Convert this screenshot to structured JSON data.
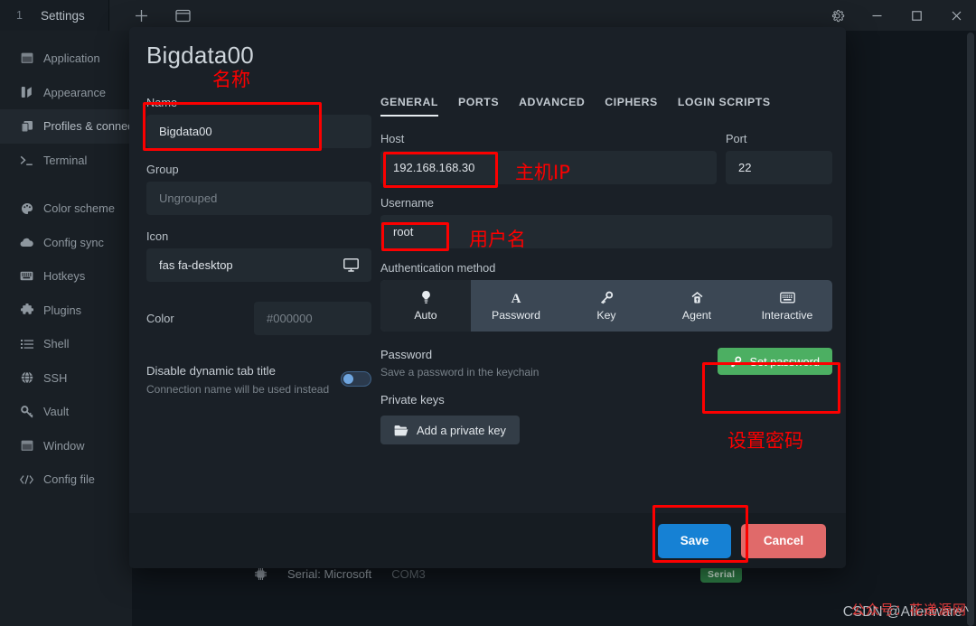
{
  "titlebar": {
    "tab_index": "1",
    "tab_label": "Settings",
    "new_tab_icon": "plus-icon",
    "split_icon": "window-split-icon",
    "gear_icon": "gear-icon",
    "minimize_label": "—",
    "maximize_label": "□",
    "close_label": "✕"
  },
  "sidebar": {
    "items": [
      {
        "label": "Application",
        "icon": "window-icon",
        "active": false
      },
      {
        "label": "Appearance",
        "icon": "palette-brush-icon",
        "active": false
      },
      {
        "label": "Profiles & connections",
        "icon": "layers-icon",
        "active": true
      },
      {
        "label": "Terminal",
        "icon": "terminal-prompt-icon",
        "active": false
      },
      {
        "label": "Color scheme",
        "icon": "palette-icon",
        "active": false
      },
      {
        "label": "Config sync",
        "icon": "cloud-icon",
        "active": false
      },
      {
        "label": "Hotkeys",
        "icon": "keyboard-icon",
        "active": false
      },
      {
        "label": "Plugins",
        "icon": "puzzle-icon",
        "active": false
      },
      {
        "label": "Shell",
        "icon": "list-icon",
        "active": false
      },
      {
        "label": "SSH",
        "icon": "globe-icon",
        "active": false
      },
      {
        "label": "Vault",
        "icon": "key-icon",
        "active": false
      },
      {
        "label": "Window",
        "icon": "window-icon",
        "active": false
      },
      {
        "label": "Config file",
        "icon": "code-icon",
        "active": false
      }
    ]
  },
  "background": {
    "connection_icon": "chip-icon",
    "connection_title": "Serial: Microsoft",
    "connection_sub": "COM3",
    "connection_badge": "Serial"
  },
  "modal": {
    "title": "Bigdata00",
    "left": {
      "name_label": "Name",
      "name_value": "Bigdata00",
      "group_label": "Group",
      "group_placeholder": "Ungrouped",
      "icon_label": "Icon",
      "icon_value": "fas fa-desktop",
      "icon_preview": "desktop-icon",
      "color_label": "Color",
      "color_placeholder": "#000000",
      "toggle_title": "Disable dynamic tab title",
      "toggle_sub": "Connection name will be used instead",
      "toggle_state": "off"
    },
    "tabs": [
      {
        "label": "GENERAL",
        "active": true
      },
      {
        "label": "PORTS",
        "active": false
      },
      {
        "label": "ADVANCED",
        "active": false
      },
      {
        "label": "CIPHERS",
        "active": false
      },
      {
        "label": "LOGIN SCRIPTS",
        "active": false
      }
    ],
    "general": {
      "host_label": "Host",
      "host_value": "192.168.168.30",
      "port_label": "Port",
      "port_value": "22",
      "username_label": "Username",
      "username_value": "root",
      "auth_label": "Authentication method",
      "auth_methods": [
        {
          "label": "Auto",
          "icon": "lightbulb-icon",
          "active": true
        },
        {
          "label": "Password",
          "icon": "letter-a-icon",
          "active": false
        },
        {
          "label": "Key",
          "icon": "key-icon",
          "active": false
        },
        {
          "label": "Agent",
          "icon": "agent-icon",
          "active": false
        },
        {
          "label": "Interactive",
          "icon": "keyboard-icon",
          "active": false
        }
      ],
      "password_title": "Password",
      "password_sub": "Save a password in the keychain",
      "set_password_label": "Set password",
      "set_password_icon": "key-icon",
      "private_keys_title": "Private keys",
      "add_private_key_label": "Add a private key",
      "add_private_key_icon": "folder-open-icon"
    },
    "footer": {
      "save_label": "Save",
      "cancel_label": "Cancel"
    }
  },
  "annotations": {
    "name_cn": "名称",
    "host_cn": "主机IP",
    "username_cn": "用户名",
    "password_cn": "设置密码"
  },
  "watermark": {
    "text": "CSDN @Alienware^",
    "overlay": "公众号：花递源网"
  },
  "colors": {
    "accent_blue": "#1681d4",
    "danger_red": "#e06a6a",
    "success_green": "#4caf62",
    "annotation_red": "#fc0000",
    "badge_green": "#2e7d46"
  }
}
